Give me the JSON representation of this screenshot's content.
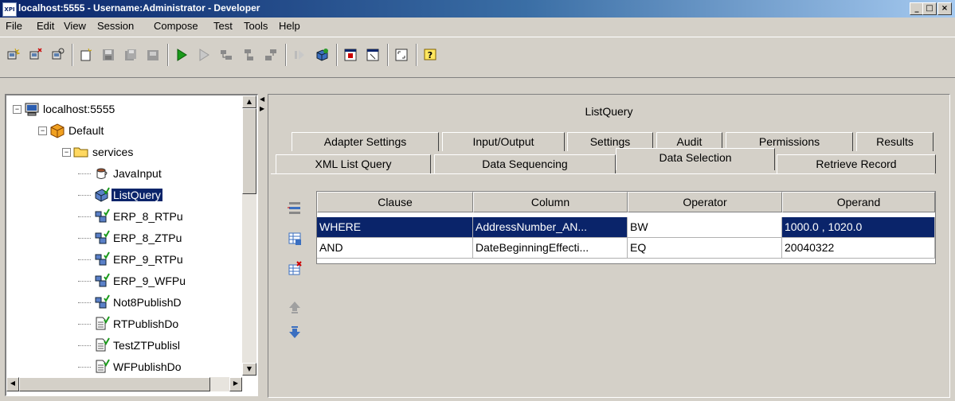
{
  "window": {
    "title": "localhost:5555 - Username:Administrator - Developer",
    "app_icon_text": "XPI",
    "controls": {
      "minimize": "_",
      "maximize": "□",
      "close": "×"
    }
  },
  "menu": [
    "File",
    "Edit",
    "View",
    "Session",
    "Compose",
    "Test",
    "Tools",
    "Help"
  ],
  "toolbar": {
    "icons": [
      "new-server-icon",
      "remove-server-icon",
      "refresh-server-icon",
      "new-element-icon",
      "save-icon",
      "save-all-icon",
      "unlock-icon",
      "run-icon",
      "run-disabled-icon",
      "step-icon",
      "step-into-icon",
      "step-out-icon",
      "trace-disabled-icon",
      "build-icon",
      "window-icon",
      "restore-icon",
      "fit-icon",
      "help-icon"
    ]
  },
  "tree": {
    "items": [
      {
        "label": "localhost:5555",
        "icon": "server-icon",
        "depth": 0,
        "expander": "−"
      },
      {
        "label": "Default",
        "icon": "package-icon",
        "depth": 1,
        "expander": "−"
      },
      {
        "label": "services",
        "icon": "folder-icon",
        "depth": 2,
        "expander": "−"
      },
      {
        "label": "JavaInput",
        "icon": "java-service-icon",
        "depth": 3
      },
      {
        "label": "ListQuery",
        "icon": "adapter-service-icon",
        "depth": 3,
        "selected": true
      },
      {
        "label": "ERP_8_RTPu",
        "icon": "flow-service-icon",
        "depth": 3
      },
      {
        "label": "ERP_8_ZTPu",
        "icon": "flow-service-icon",
        "depth": 3
      },
      {
        "label": "ERP_9_RTPu",
        "icon": "flow-service-icon",
        "depth": 3
      },
      {
        "label": "ERP_9_WFPu",
        "icon": "flow-service-icon",
        "depth": 3
      },
      {
        "label": "Not8PublishD",
        "icon": "flow-service-icon",
        "depth": 3
      },
      {
        "label": "RTPublishDo",
        "icon": "document-icon",
        "depth": 3
      },
      {
        "label": "TestZTPublisl",
        "icon": "document-icon",
        "depth": 3
      },
      {
        "label": "WFPublishDo",
        "icon": "document-icon",
        "depth": 3
      }
    ]
  },
  "panel": {
    "title": "ListQuery",
    "tabs_row1": [
      "Adapter Settings",
      "Input/Output",
      "Settings",
      "Audit",
      "Permissions",
      "Results"
    ],
    "tabs_row2": [
      "XML List Query",
      "Data Sequencing",
      "Data Selection",
      "Retrieve Record"
    ],
    "active_tab": "Data Selection"
  },
  "table": {
    "columns": [
      "Clause",
      "Column",
      "Operator",
      "Operand"
    ],
    "rows": [
      {
        "clause": "WHERE",
        "column": "AddressNumber_AN...",
        "operator": "BW",
        "operand": "1000.0 , 1020.0",
        "selected": true
      },
      {
        "clause": "AND",
        "column": "DateBeginningEffecti...",
        "operator": "EQ",
        "operand": "20040322",
        "selected": false
      }
    ]
  },
  "side_tools": [
    "insert-row-icon",
    "add-row-icon",
    "delete-row-icon",
    "move-up-icon",
    "move-down-icon"
  ],
  "colors": {
    "selection": "#0a246a",
    "face": "#d4d0c8",
    "run_green": "#1a9a1a"
  }
}
